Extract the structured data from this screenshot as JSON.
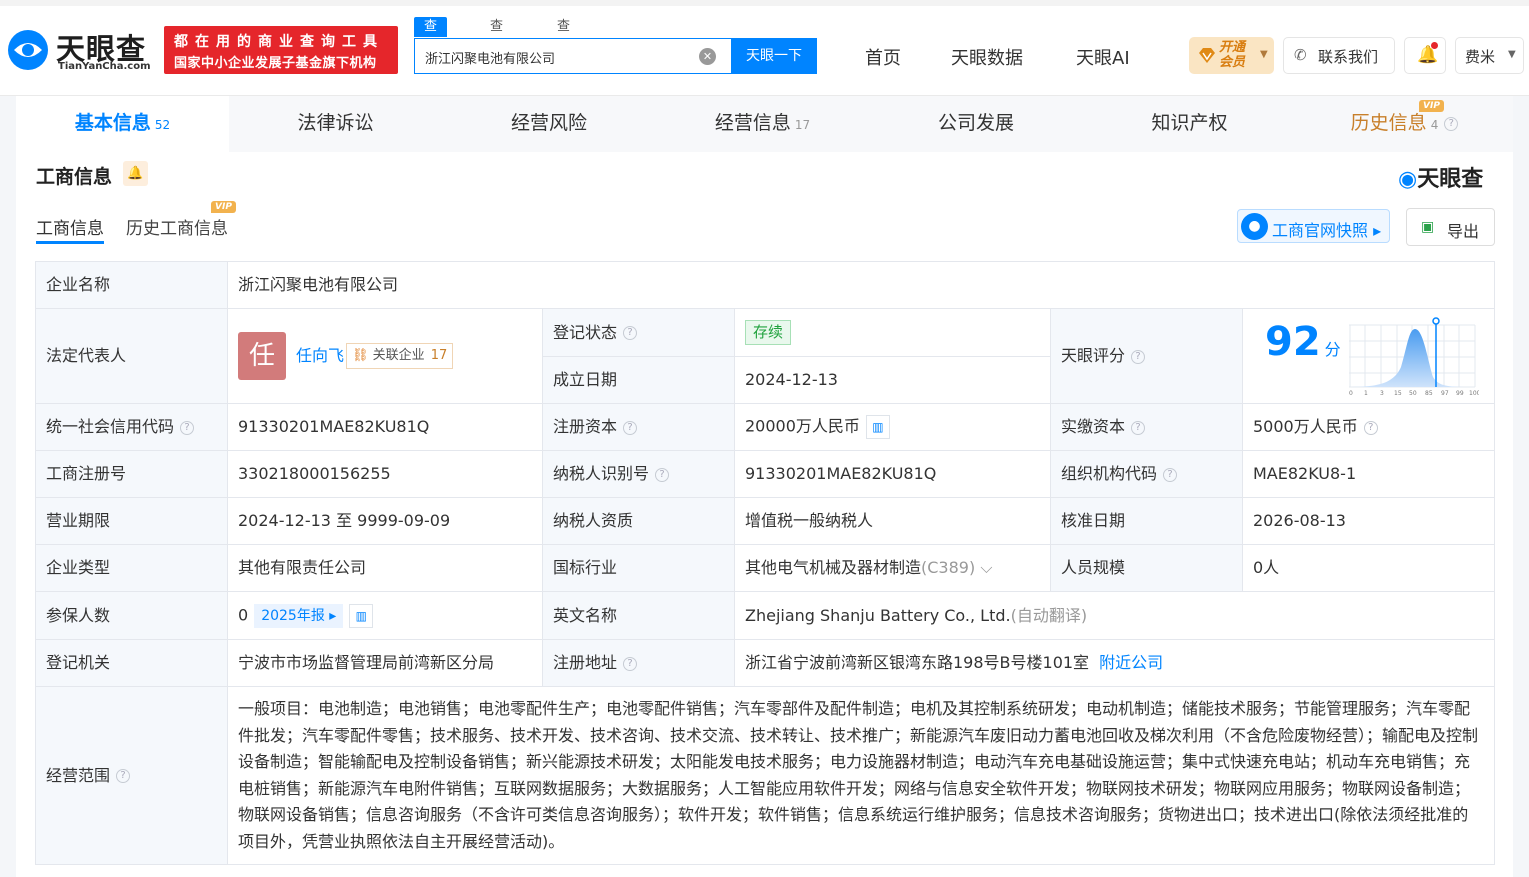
{
  "header": {
    "logo_text": "天眼查",
    "logo_url": "TianYanCha.com",
    "slogan_line1": "都在用的商业查询工具",
    "slogan_line2": "国家中小企业发展子基金旗下机构",
    "search_tabs": [
      "查公司",
      "查老板",
      "查关系"
    ],
    "search_value": "浙江闪聚电池有限公司",
    "search_button": "天眼一下",
    "nav": [
      "首页",
      "天眼数据",
      "天眼AI"
    ],
    "vip_line1": "开通",
    "vip_line2": "会员",
    "contact": "联系我们",
    "user": "费米"
  },
  "tabs": [
    {
      "label": "基本信息",
      "count": "52"
    },
    {
      "label": "法律诉讼",
      "count": ""
    },
    {
      "label": "经营风险",
      "count": ""
    },
    {
      "label": "经营信息",
      "count": "17"
    },
    {
      "label": "公司发展",
      "count": ""
    },
    {
      "label": "知识产权",
      "count": ""
    },
    {
      "label": "历史信息",
      "count": "4"
    }
  ],
  "vip_label": "VIP",
  "section": {
    "title": "工商信息",
    "brand": "天眼查",
    "sub_tabs": [
      "工商信息",
      "历史工商信息"
    ],
    "snapshot_button": "工商官网快照",
    "export_button": "导出"
  },
  "info": {
    "company_name_label": "企业名称",
    "company_name": "浙江闪聚电池有限公司",
    "legal_rep_label": "法定代表人",
    "legal_rep_avatar": "任",
    "legal_rep_name": "任向飞",
    "related_label": "关联企业",
    "related_count": "17",
    "reg_status_label": "登记状态",
    "reg_status": "存续",
    "found_date_label": "成立日期",
    "found_date": "2024-12-13",
    "score_label": "天眼评分",
    "score": "92",
    "score_unit": "分",
    "score_axis": [
      "0",
      "1",
      "3",
      "15",
      "50",
      "85",
      "97",
      "99",
      "100"
    ],
    "credit_code_label": "统一社会信用代码",
    "credit_code": "91330201MAE82KU81Q",
    "reg_capital_label": "注册资本",
    "reg_capital": "20000万人民币",
    "paid_capital_label": "实缴资本",
    "paid_capital": "5000万人民币",
    "reg_no_label": "工商注册号",
    "reg_no": "330218000156255",
    "taxpayer_id_label": "纳税人识别号",
    "taxpayer_id": "91330201MAE82KU81Q",
    "org_code_label": "组织机构代码",
    "org_code": "MAE82KU8-1",
    "term_label": "营业期限",
    "term": "2024-12-13 至 9999-09-09",
    "taxpayer_qual_label": "纳税人资质",
    "taxpayer_qual": "增值税一般纳税人",
    "approve_date_label": "核准日期",
    "approve_date": "2026-08-13",
    "type_label": "企业类型",
    "type": "其他有限责任公司",
    "industry_label": "国标行业",
    "industry": "其他电气机械及器材制造",
    "industry_code": "(C389)",
    "staff_label": "人员规模",
    "staff": "0人",
    "insured_label": "参保人数",
    "insured": "0",
    "insured_year": "2025年报",
    "en_name_label": "英文名称",
    "en_name": "Zhejiang Shanju Battery Co., Ltd.",
    "en_name_note": "(自动翻译)",
    "authority_label": "登记机关",
    "authority": "宁波市市场监督管理局前湾新区分局",
    "address_label": "注册地址",
    "address": "浙江省宁波前湾新区银湾东路198号B号楼101室",
    "nearby_link": "附近公司",
    "scope_label": "经营范围",
    "scope": "一般项目：电池制造；电池销售；电池零配件生产；电池零配件销售；汽车零部件及配件制造；电机及其控制系统研发；电动机制造；储能技术服务；节能管理服务；汽车零配件批发；汽车零配件零售；技术服务、技术开发、技术咨询、技术交流、技术转让、技术推广；新能源汽车废旧动力蓄电池回收及梯次利用（不含危险废物经营）；输配电及控制设备制造；智能输配电及控制设备销售；新兴能源技术研发；太阳能发电技术服务；电力设施器材制造；电动汽车充电基础设施运营；集中式快速充电站；机动车充电销售；充电桩销售；新能源汽车电附件销售；互联网数据服务；大数据服务；人工智能应用软件开发；网络与信息安全软件开发；物联网技术研发；物联网应用服务；物联网设备制造；物联网设备销售；信息咨询服务（不含许可类信息咨询服务）；软件开发；软件销售；信息系统运行维护服务；信息技术咨询服务；货物进出口；技术进出口(除依法须经批准的项目外，凭营业执照依法自主开展经营活动)。"
  },
  "colors": {
    "accent": "#0084ff",
    "slogan_bg": "#e5262b",
    "status_green": "#21a23e",
    "vip_gold": "#d87d10"
  }
}
